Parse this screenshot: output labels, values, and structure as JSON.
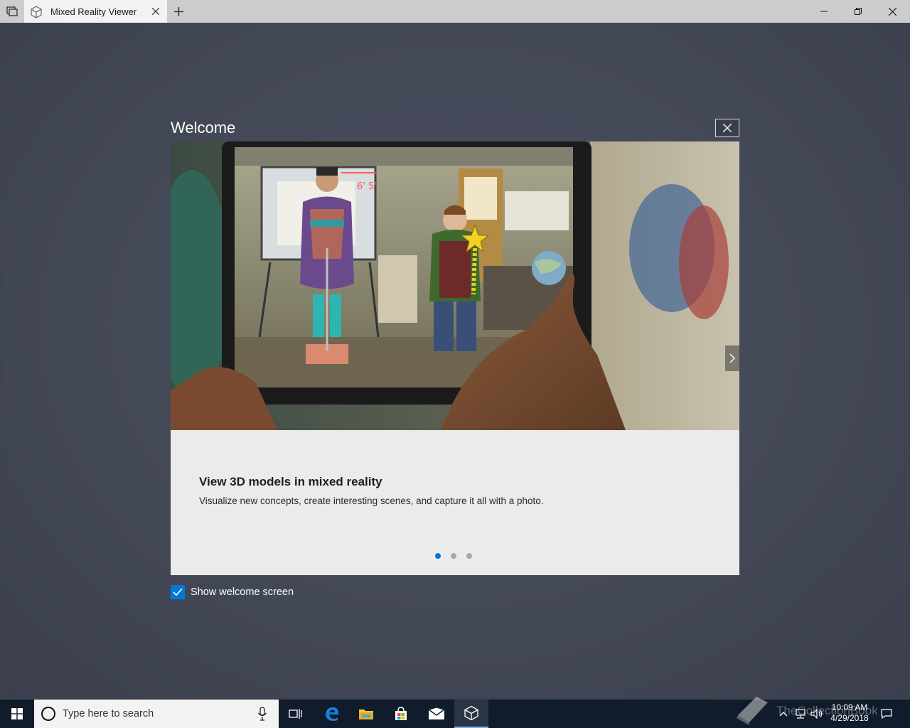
{
  "window": {
    "tab_title": "Mixed Reality Viewer",
    "controls": {
      "minimize": "minimize",
      "restore": "restore",
      "close": "close"
    }
  },
  "dialog": {
    "title": "Welcome",
    "slide_heading": "View 3D models in mixed reality",
    "slide_description": "Visualize new concepts, create interesting scenes, and capture it all with a photo.",
    "hero_overlay_text": "6' 5\"",
    "slide_count": 3,
    "active_slide": 1
  },
  "show_welcome": {
    "label": "Show welcome screen",
    "checked": true
  },
  "taskbar": {
    "search_placeholder": "Type here to search",
    "time": "10:09 AM",
    "date": "4/29/2018",
    "watermark": "TheCollectionBook"
  },
  "colors": {
    "accent": "#0078d7",
    "titlebar": "#cccccc",
    "taskbar": "#101b2b",
    "backdrop": "#454a59"
  }
}
